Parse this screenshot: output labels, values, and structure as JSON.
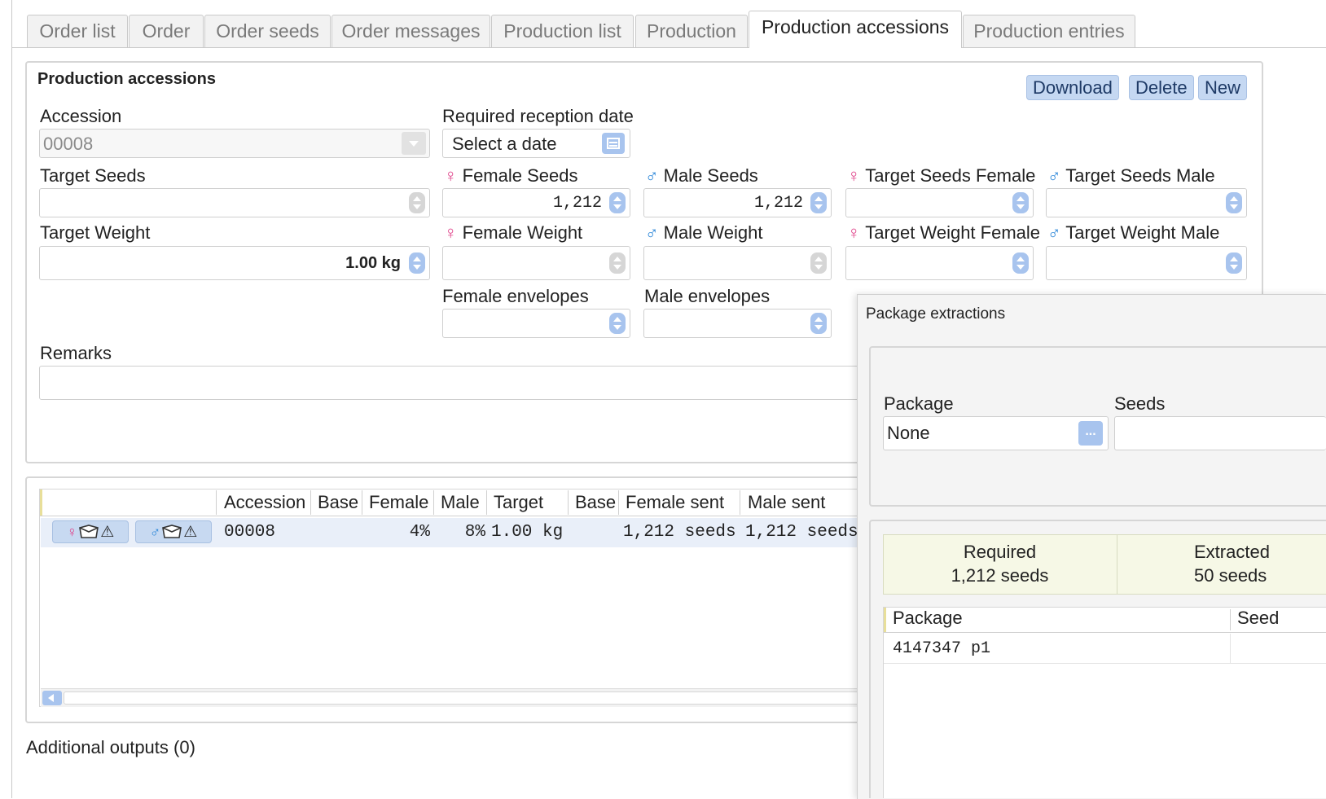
{
  "tabs": [
    {
      "label": "Order list"
    },
    {
      "label": "Order"
    },
    {
      "label": "Order seeds"
    },
    {
      "label": "Order messages"
    },
    {
      "label": "Production list"
    },
    {
      "label": "Production"
    },
    {
      "label": "Production accessions",
      "active": true
    },
    {
      "label": "Production entries"
    }
  ],
  "form": {
    "title": "Production accessions",
    "buttons": {
      "download": "Download",
      "delete": "Delete",
      "new": "New"
    },
    "accession": {
      "label": "Accession",
      "value": "00008"
    },
    "reception_date": {
      "label": "Required reception date",
      "placeholder": "Select a date"
    },
    "target_seeds": {
      "label": "Target Seeds",
      "value": ""
    },
    "female_seeds": {
      "label": "Female Seeds",
      "value": "1,212"
    },
    "male_seeds": {
      "label": "Male Seeds",
      "value": "1,212"
    },
    "target_seeds_female": {
      "label": "Target Seeds Female"
    },
    "target_seeds_male": {
      "label": "Target Seeds Male"
    },
    "target_weight": {
      "label": "Target Weight",
      "value": "1.00 kg"
    },
    "female_weight": {
      "label": "Female Weight"
    },
    "male_weight": {
      "label": "Male Weight"
    },
    "target_weight_female": {
      "label": "Target Weight Female"
    },
    "target_weight_male": {
      "label": "Target Weight Male"
    },
    "female_envelopes": {
      "label": "Female envelopes"
    },
    "male_envelopes": {
      "label": "Male envelopes"
    },
    "remarks": {
      "label": "Remarks",
      "value": ""
    }
  },
  "symbols": {
    "female": "♀",
    "male": "♂",
    "warning": "⚠",
    "ellipsis": "..."
  },
  "table": {
    "columns": [
      "Accession",
      "Base",
      "Female",
      "Male",
      "Target",
      "Base",
      "Female sent",
      "Male sent"
    ],
    "rows": [
      {
        "accession": "00008",
        "base": "",
        "female": "4%",
        "male": "8%",
        "target": "1.00 kg",
        "base2": "",
        "female_sent": "1,212 seeds",
        "male_sent": "1,212 seeds"
      }
    ]
  },
  "additional_outputs": "Additional outputs (0)",
  "popup": {
    "title": "Package extractions",
    "package_label": "Package",
    "package_value": "None",
    "seeds_label": "Seeds",
    "required": {
      "label": "Required",
      "value": "1,212 seeds"
    },
    "extracted": {
      "label": "Extracted",
      "value": "50 seeds"
    },
    "columns": [
      "Package",
      "Seed"
    ],
    "rows": [
      {
        "package": "4147347 p1"
      }
    ]
  },
  "colors": {
    "accent": "#c5d8f2",
    "female": "#e0458b",
    "male": "#2b86d8",
    "summary_bg": "#f6f8e6"
  }
}
